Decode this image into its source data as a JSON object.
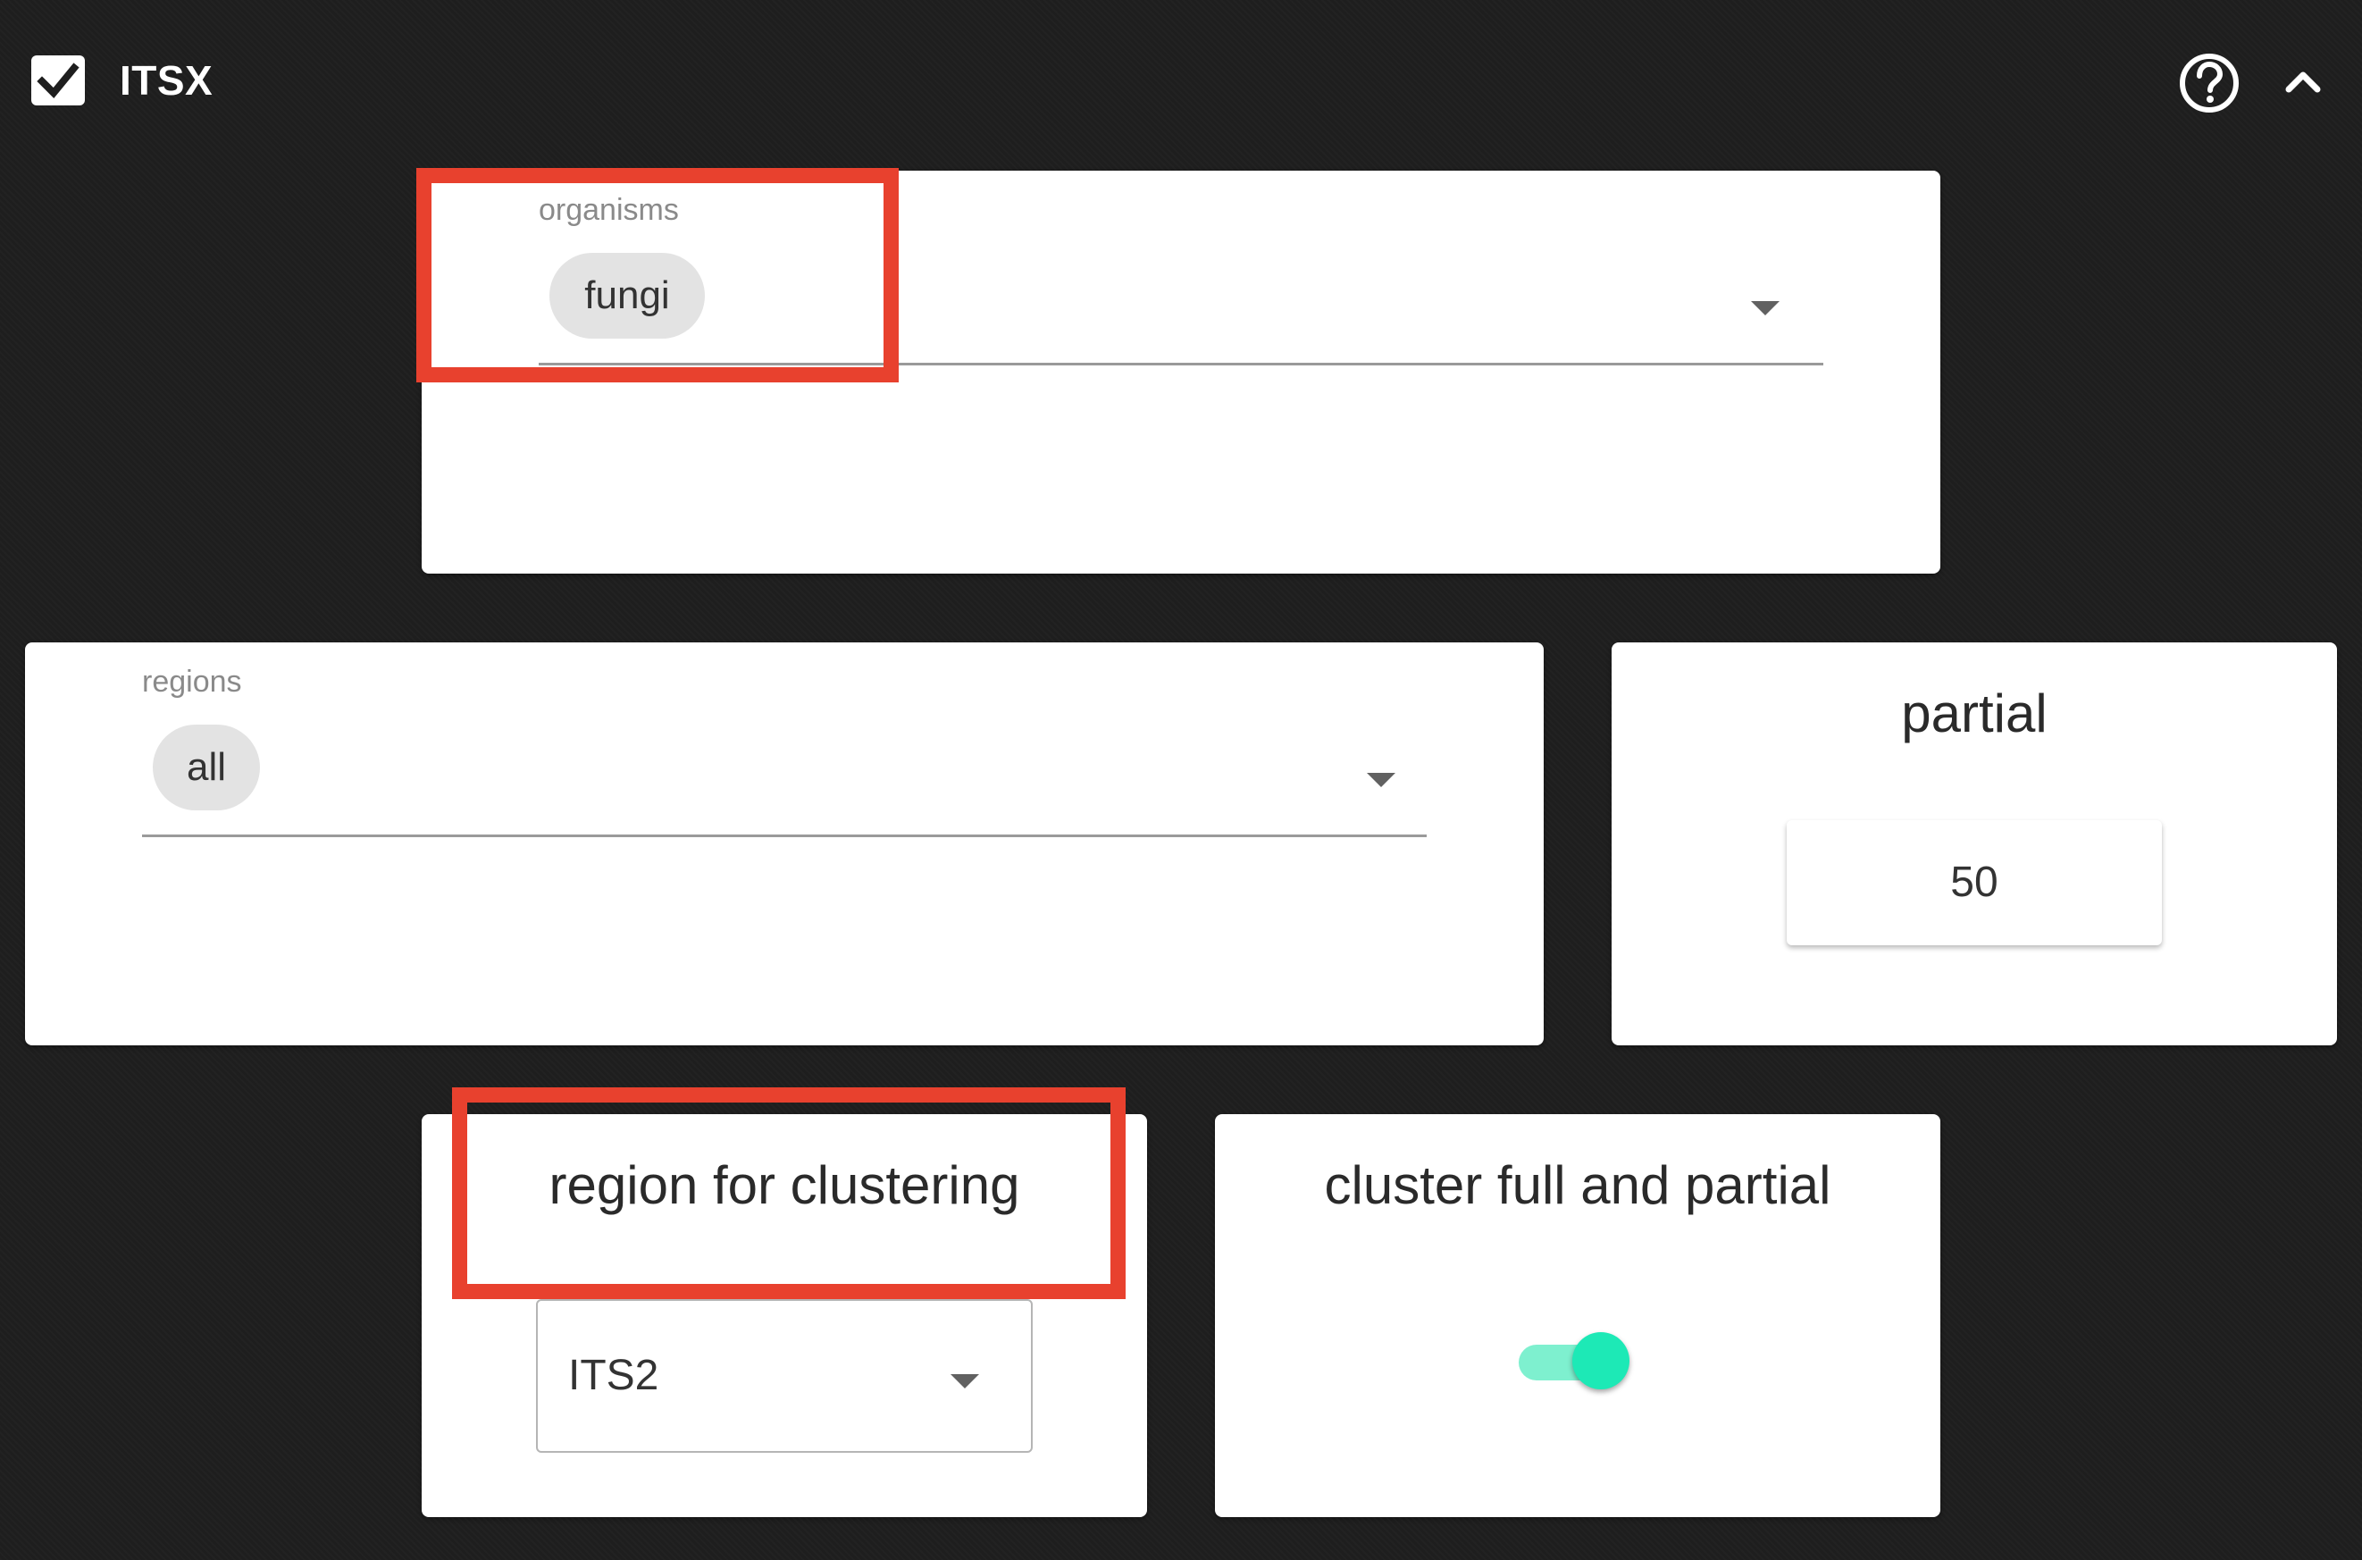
{
  "header": {
    "title": "ITSX",
    "enabled": true,
    "icons": {
      "checkbox": "checkbox-checked-icon",
      "help": "help-circle-icon",
      "collapse": "chevron-up-icon"
    }
  },
  "organisms": {
    "label": "organisms",
    "selected": [
      "fungi"
    ]
  },
  "regions": {
    "label": "regions",
    "selected": [
      "all"
    ]
  },
  "partial": {
    "title": "partial",
    "value": "50"
  },
  "region_for_clustering": {
    "title": "region for clustering",
    "value": "ITS2"
  },
  "cluster_full_and_partial": {
    "title": "cluster full and partial",
    "enabled": true
  },
  "colors": {
    "background": "#1e1e1e",
    "card": "#ffffff",
    "toggle_accent": "#1de9b6",
    "highlight": "#e8412e"
  }
}
